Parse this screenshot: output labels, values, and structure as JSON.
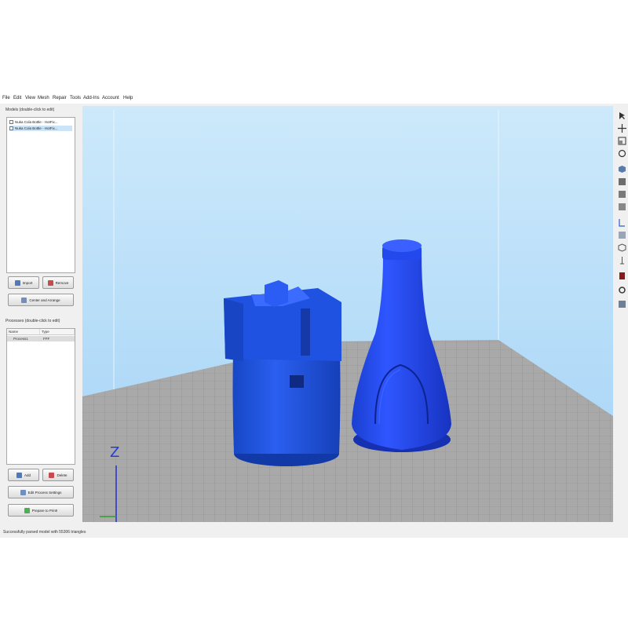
{
  "menu": [
    "File",
    "Edit",
    "View",
    "Mesh",
    "Repair",
    "Tools",
    "Add-Ins",
    "Account",
    "Help"
  ],
  "models_panel": {
    "title": "Models (double-click to edit)",
    "items": [
      "Nuka Cola Bottle - HotFix...",
      "Nuka Cola Bottle - HotFix..."
    ]
  },
  "model_buttons": {
    "import": "Import",
    "remove": "Remove",
    "center_arrange": "Center and Arrange"
  },
  "processes_panel": {
    "title": "Processes (double-click to edit)",
    "columns": [
      "Name",
      "Type"
    ],
    "rows": [
      {
        "name": "Process1",
        "type": "FFF"
      }
    ]
  },
  "process_buttons": {
    "add": "Add",
    "delete": "Delete",
    "edit": "Edit Process Settings",
    "prepare": "Prepare to Print!"
  },
  "viewport": {
    "z_axis_label": "Z",
    "model_color": "#1f4fe0",
    "background_top": "#cde9fb",
    "background_bottom": "#a3d3f6",
    "bed_color": "#a8a8a8"
  },
  "toolbar_icons": [
    "select-icon",
    "move-icon",
    "scale-icon",
    "rotate-icon",
    "view-iso-icon",
    "view-front-icon",
    "view-top-icon",
    "view-side-icon",
    "view-right-icon",
    "view-bottom-icon",
    "view-back-icon",
    "shade-icon",
    "section-icon",
    "color-icon",
    "settings-icon",
    "box-icon"
  ],
  "status": {
    "text": "Successfully parsed model with 55306 triangles"
  },
  "colors": {
    "accent": "#1f4fe0",
    "panel": "#f0f0f0"
  }
}
